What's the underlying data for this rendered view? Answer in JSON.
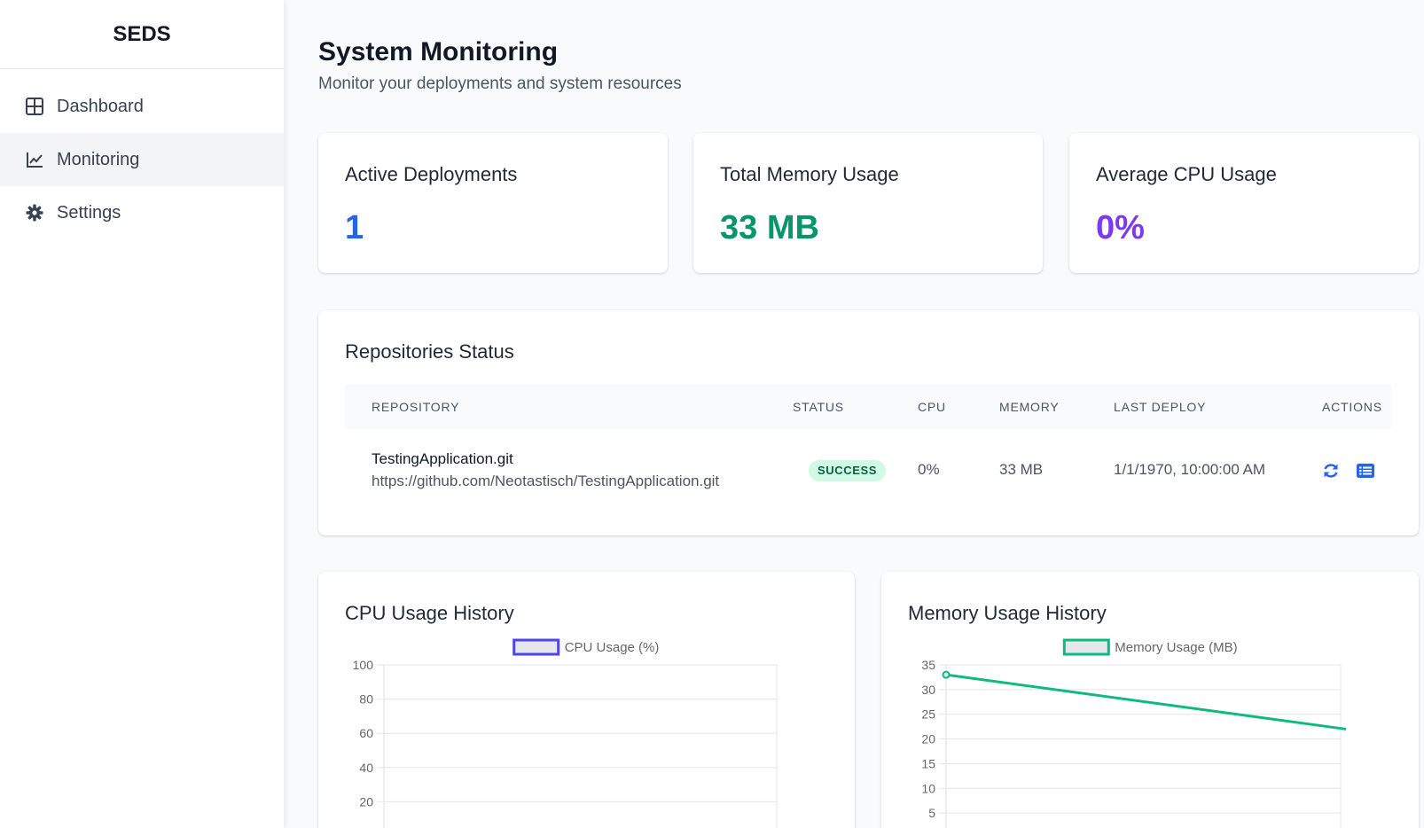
{
  "app": {
    "brand": "SEDS"
  },
  "sidebar": {
    "items": [
      {
        "label": "Dashboard",
        "icon": "grid-icon"
      },
      {
        "label": "Monitoring",
        "icon": "chart-line-icon",
        "active": true
      },
      {
        "label": "Settings",
        "icon": "gear-icon"
      }
    ]
  },
  "header": {
    "title": "System Monitoring",
    "subtitle": "Monitor your deployments and system resources"
  },
  "stats": [
    {
      "title": "Active Deployments",
      "value": "1",
      "color": "#2563eb"
    },
    {
      "title": "Total Memory Usage",
      "value": "33 MB",
      "color": "#059669"
    },
    {
      "title": "Average CPU Usage",
      "value": "0%",
      "color": "#7c3aed"
    }
  ],
  "repositories": {
    "title": "Repositories Status",
    "columns": [
      "REPOSITORY",
      "STATUS",
      "CPU",
      "MEMORY",
      "LAST DEPLOY",
      "ACTIONS"
    ],
    "rows": [
      {
        "name": "TestingApplication.git",
        "url": "https://github.com/Neotastisch/TestingApplication.git",
        "status": "SUCCESS",
        "cpu": "0%",
        "memory": "33 MB",
        "last_deploy": "1/1/1970, 10:00:00 AM",
        "actions": [
          "refresh-icon",
          "logs-icon"
        ]
      }
    ]
  },
  "chart_data": [
    {
      "type": "line",
      "title": "CPU Usage History",
      "series": [
        {
          "name": "CPU Usage (%)",
          "color": "#4f46e5",
          "values": []
        }
      ],
      "y_ticks": [
        100,
        80,
        60,
        40,
        20
      ],
      "ylim": [
        0,
        100
      ],
      "legend": "top",
      "grid": true
    },
    {
      "type": "line",
      "title": "Memory Usage History",
      "series": [
        {
          "name": "Memory Usage (MB)",
          "color": "#10b981",
          "values": [
            33,
            22
          ]
        }
      ],
      "y_ticks": [
        35,
        30,
        25,
        20,
        15,
        10,
        5
      ],
      "ylim": [
        0,
        35
      ],
      "legend": "top",
      "grid": true
    }
  ]
}
